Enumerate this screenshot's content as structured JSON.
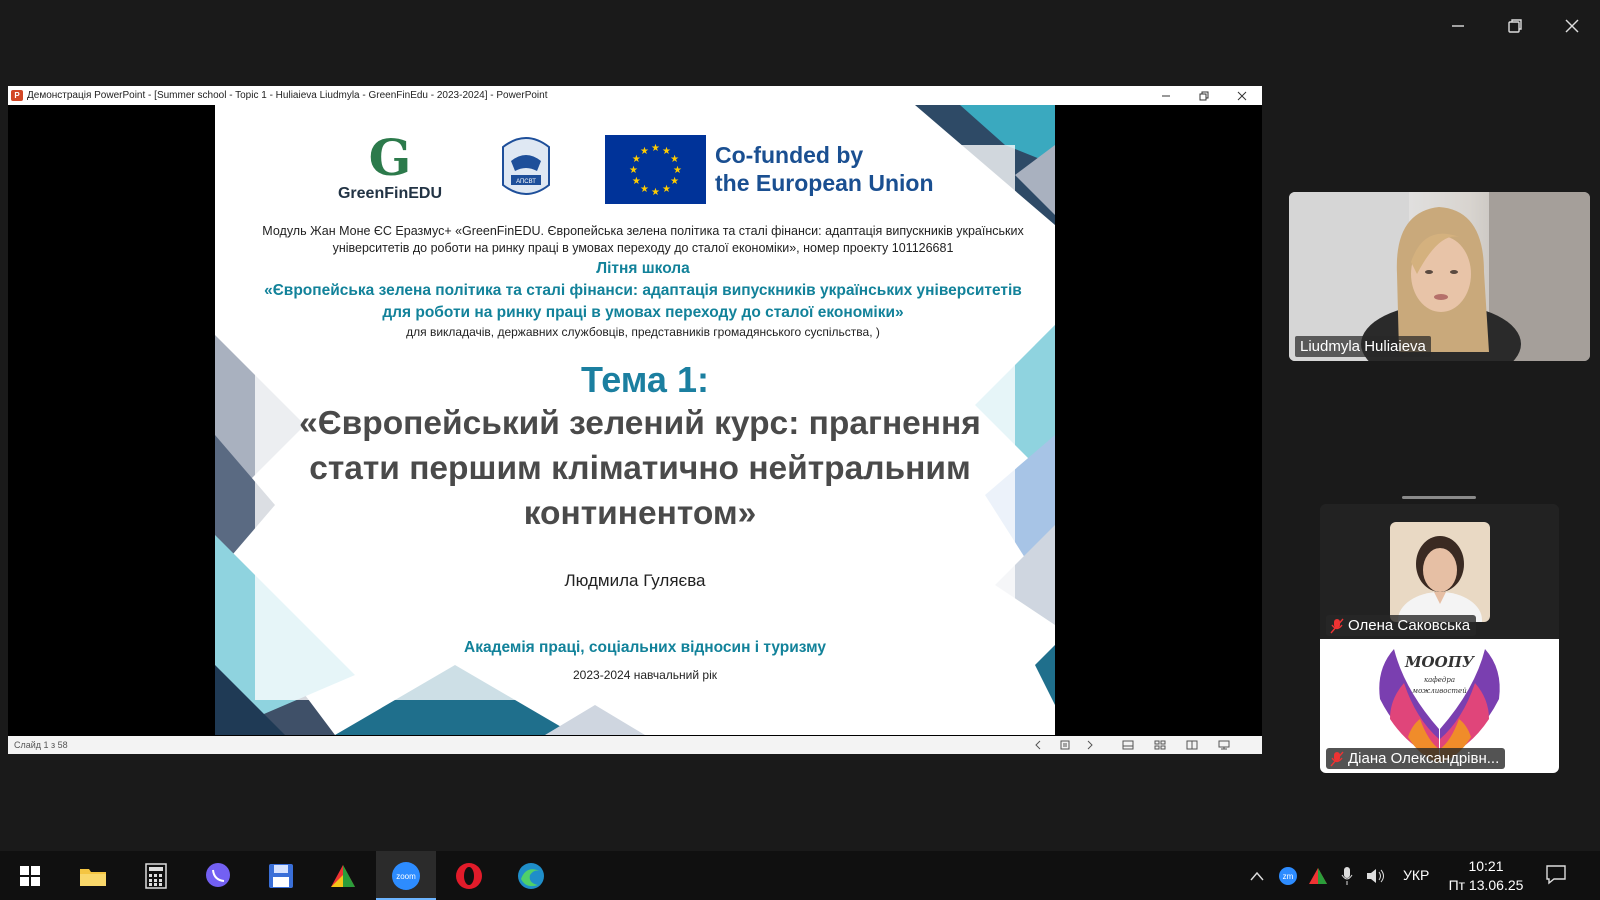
{
  "ppt_window": {
    "title": "Демонстрація PowerPoint - [Summer school - Topic 1 - Huliaieva Liudmyla - GreenFinEdu - 2023-2024] - PowerPoint",
    "icon_letter": "P",
    "status": "Слайд 1 з 58"
  },
  "slide": {
    "greenfin_logo": "GreenFinEDU",
    "greenfin_mark": "G",
    "apsvt_logo": "АПСВТ",
    "eu_text": "Co-funded by\nthe European Union",
    "module_description": "Модуль Жан Моне ЄС Еразмус+ «GreenFinEDU. Європейська зелена політика та сталі фінанси: адаптація випускників українських університетів до роботи на ринку праці в умовах переходу до сталої економіки», номер проекту 101126681",
    "summer_school_title": "Літня школа",
    "summer_school_quote": "«Європейська зелена політика та сталі фінанси: адаптація випускників українських університетів для роботи на ринку праці в умовах переходу до сталої економіки»",
    "audience": "для викладачів, державних службовців, представників громадянського суспільства, )",
    "topic_number": "Тема 1:",
    "topic_title": "«Європейський зелений курс: прагнення стати першим кліматично нейтральним континентом»",
    "author": "Людмила Гуляєва",
    "academy": "Академія праці, соціальних відносин і туризму",
    "academic_year": "2023-2024 навчальний рік"
  },
  "participants": {
    "speaker": "Liudmyla Huliaieva",
    "p2": "Олена Саковська",
    "p3": "Діана Олександрівн...",
    "p3_logo": "МООПУ",
    "p3_logo_sub": "кафедра\nможливостей"
  },
  "taskbar": {
    "language": "УКР",
    "time": "10:21",
    "date": "Пт 13.06.25",
    "zoom_label": "zoom",
    "zoom_tray_label": "zm"
  },
  "colors": {
    "slide_teal": "#12829a",
    "topic_blue": "#1b7fa0",
    "eu_blue": "#003399",
    "taskbar": "#101010"
  }
}
